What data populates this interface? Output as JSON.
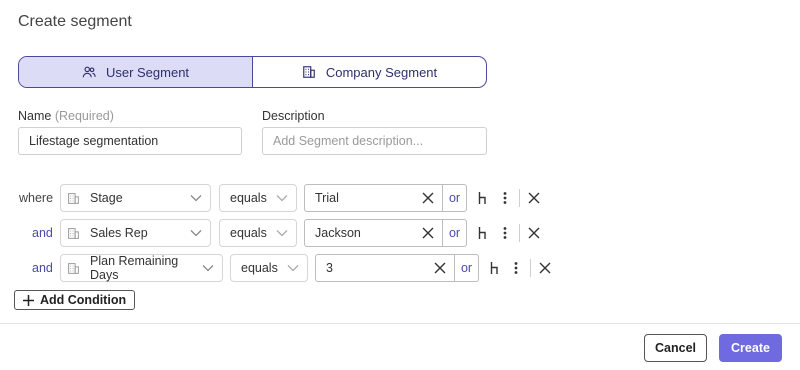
{
  "dialog": {
    "title": "Create segment"
  },
  "segment_type": {
    "options": [
      {
        "label": "User Segment",
        "icon": "users-icon",
        "active": true
      },
      {
        "label": "Company Segment",
        "icon": "building-icon",
        "active": false
      }
    ]
  },
  "form": {
    "name_label": "Name",
    "name_required": "(Required)",
    "name_value": "Lifestage segmentation",
    "description_label": "Description",
    "description_placeholder": "Add Segment description..."
  },
  "conditions": [
    {
      "connector": "where",
      "property": "Stage",
      "operator": "equals",
      "value": "Trial",
      "or_label": "or"
    },
    {
      "connector": "and",
      "property": "Sales Rep",
      "operator": "equals",
      "value": "Jackson",
      "or_label": "or"
    },
    {
      "connector": "and",
      "property": "Plan Remaining Days",
      "operator": "equals",
      "value": "3",
      "or_label": "or"
    }
  ],
  "add_condition_label": "Add Condition",
  "footer": {
    "cancel_label": "Cancel",
    "create_label": "Create"
  },
  "colors": {
    "accent": "#6f6ae0",
    "toggle_active_bg": "#dcdcf7",
    "link": "#4a4aa8"
  }
}
